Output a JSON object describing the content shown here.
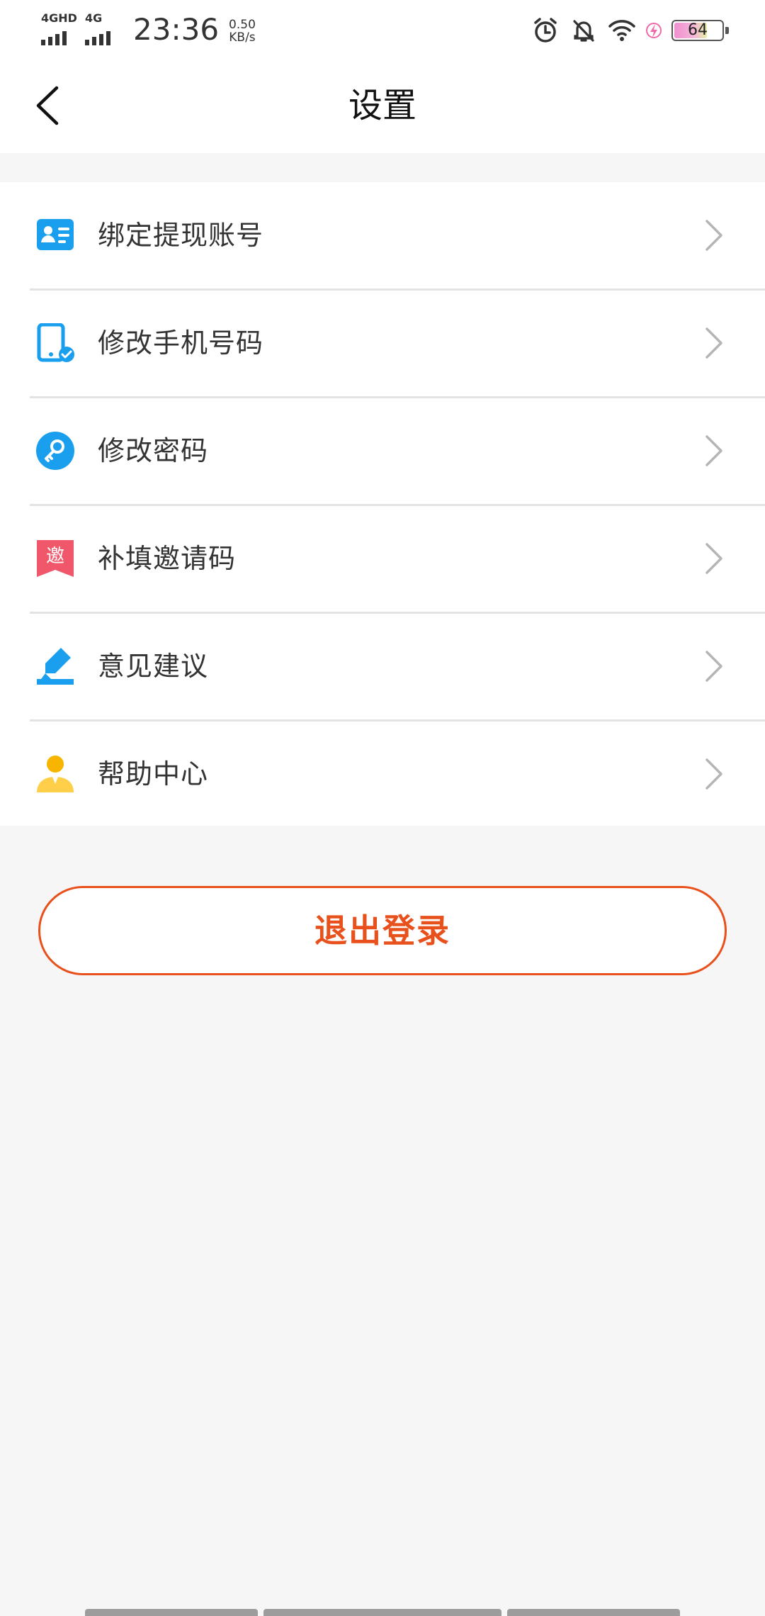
{
  "status_bar": {
    "network1": "4GHD",
    "network2": "4G",
    "time": "23:36",
    "speed_value": "0.50",
    "speed_unit": "KB/s",
    "battery": "64"
  },
  "header": {
    "title": "设置"
  },
  "menu": {
    "items": [
      {
        "label": "绑定提现账号",
        "icon": "id-card-icon"
      },
      {
        "label": "修改手机号码",
        "icon": "phone-verified-icon"
      },
      {
        "label": "修改密码",
        "icon": "key-icon"
      },
      {
        "label": "补填邀请码",
        "icon": "invite-badge-icon",
        "icon_text": "邀"
      },
      {
        "label": "意见建议",
        "icon": "pen-edit-icon"
      },
      {
        "label": "帮助中心",
        "icon": "support-person-icon"
      }
    ]
  },
  "logout": {
    "label": "退出登录"
  },
  "colors": {
    "accent": "#e8501c",
    "icon_blue": "#1a9fee",
    "icon_red": "#f0576b",
    "icon_yellow": "#f7b500"
  }
}
